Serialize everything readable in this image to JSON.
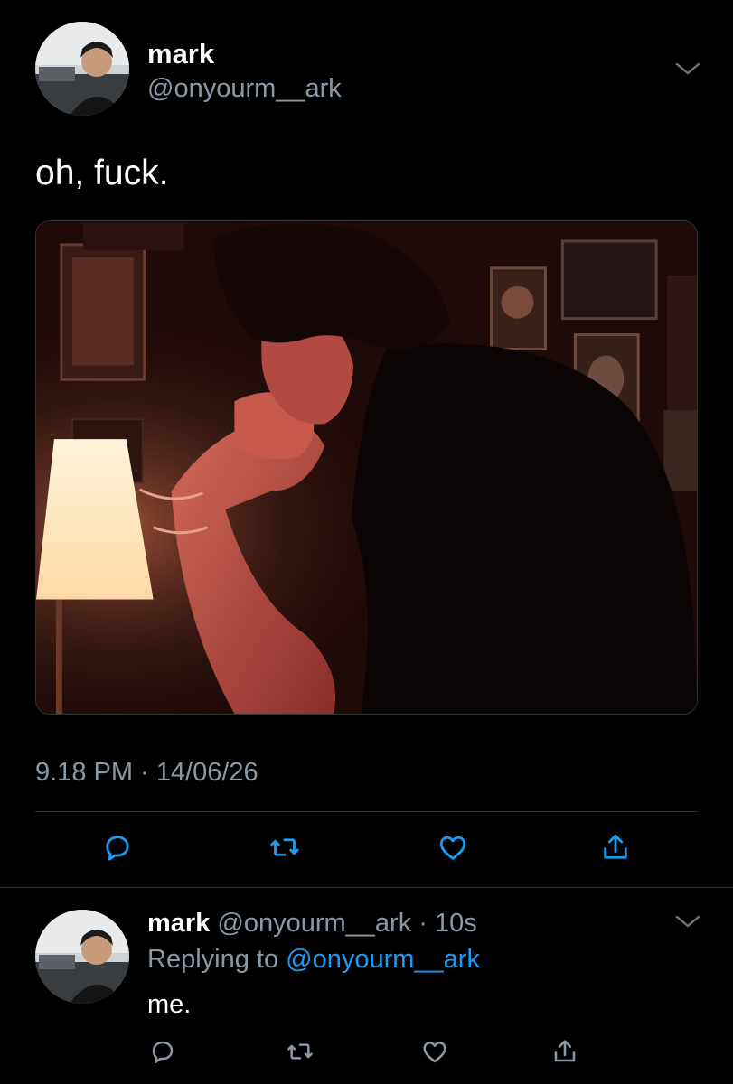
{
  "tweet": {
    "author_name": "mark",
    "author_handle": "@onyourm__ark",
    "text": "oh, fuck.",
    "timestamp": "9.18 PM · 14/06/26",
    "media_description": "photo"
  },
  "reply": {
    "author_name": "mark",
    "meta": "@onyourm__ark · 10s",
    "replying_prefix": "Replying to ",
    "replying_to": "@onyourm__ark",
    "text": "me."
  },
  "icons": {
    "menu": "chevron-down-icon",
    "reply": "reply-icon",
    "retweet": "retweet-icon",
    "like": "heart-icon",
    "share": "share-icon"
  },
  "colors": {
    "background": "#000000",
    "primary_text": "#ffffff",
    "secondary_text": "#8b98a5",
    "accent": "#1d9bf0",
    "divider": "#2f3336"
  }
}
